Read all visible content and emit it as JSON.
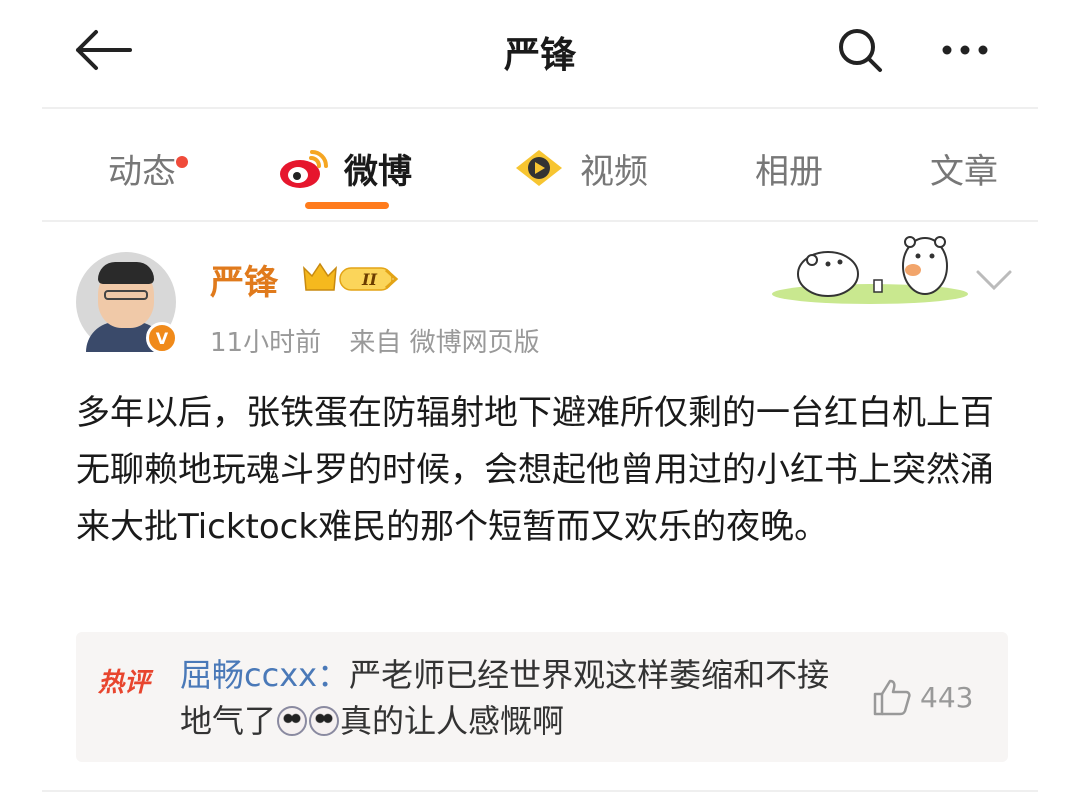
{
  "header": {
    "title": "严锋"
  },
  "tabs": [
    {
      "label": "动态",
      "has_dot": true
    },
    {
      "label": "微博",
      "active": true
    },
    {
      "label": "视频"
    },
    {
      "label": "相册"
    },
    {
      "label": "文章"
    }
  ],
  "post": {
    "author": "严锋",
    "time": "11小时前",
    "source": "来自 微博网页版",
    "text": "多年以后，张铁蛋在防辐射地下避难所仅剩的一台红白机上百无聊赖地玩魂斗罗的时候，会想起他曾用过的小红书上突然涌来大批Ticktock难民的那个短暂而又欢乐的夜晚。",
    "hot_comment": {
      "label": "热评",
      "user": "屈畅ccxx",
      "separator": "：",
      "text_before": "严老师已经世界观这样萎缩和不接地气了",
      "text_after": "真的让人感慨啊",
      "likes": "443"
    }
  },
  "colors": {
    "accent": "#ff7b1c",
    "username": "#e07a1c",
    "hot_label": "#e8452e",
    "commenter": "#4a79b8"
  },
  "icons": [
    "back-arrow-icon",
    "search-icon",
    "more-icon",
    "weibo-logo-icon",
    "video-icon",
    "vip-crown-icon",
    "chevron-down-icon",
    "thumbs-up-icon"
  ]
}
